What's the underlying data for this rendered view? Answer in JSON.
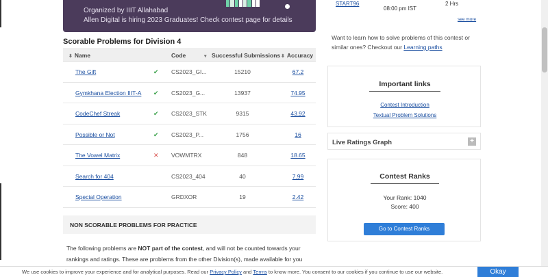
{
  "banner": {
    "line1": "Organized by IIIT Allahabad",
    "line2": "Allen Digital is hiring 2023 Graduates! Check contest page for details",
    "bar_colors": [
      "#6fd3a8",
      "#d8f0e4",
      "#6fd3a8",
      "#ffffff",
      "#d8f0e4",
      "#6fd3a8",
      "#ffffff",
      "#ffffff"
    ]
  },
  "problems": {
    "title": "Scorable Problems for Division 4",
    "headers": {
      "name": "Name",
      "code": "Code",
      "subs": "Successful Submissions",
      "acc": "Accuracy"
    },
    "rows": [
      {
        "name": "The Gift",
        "status": "solved",
        "status_icon": "✔",
        "code": "CS2023_GI...",
        "subs": "15210",
        "acc": "67.2"
      },
      {
        "name": "Gymkhana Election IIIT-A",
        "status": "solved",
        "status_icon": "✔",
        "code": "CS2023_G...",
        "subs": "13937",
        "acc": "74.95"
      },
      {
        "name": "CodeChef Streak",
        "status": "solved",
        "status_icon": "✔",
        "code": "CS2023_STK",
        "subs": "9315",
        "acc": "43.92"
      },
      {
        "name": "Possible or Not",
        "status": "solved",
        "status_icon": "✔",
        "code": "CS2023_P...",
        "subs": "1756",
        "acc": "16"
      },
      {
        "name": "The Vowel Matrix",
        "status": "wrong",
        "status_icon": "✕",
        "code": "VOWMTRX",
        "subs": "848",
        "acc": "18.65"
      },
      {
        "name": "Search for 404",
        "status": "none",
        "status_icon": "",
        "code": "CS2023_404",
        "subs": "40",
        "acc": "7.99"
      },
      {
        "name": "Special Operation",
        "status": "none",
        "status_icon": "",
        "code": "GRDXOR",
        "subs": "19",
        "acc": "2.42"
      }
    ]
  },
  "nonscorable": {
    "label": "NON SCORABLE PROBLEMS FOR PRACTICE",
    "para_pre": "The following problems are ",
    "para_bold": "NOT part of the contest",
    "para_post": ", and will not be counted towards your rankings and ratings. These are problems from the other Division(s), made available for you"
  },
  "sidebar": {
    "calendar": {
      "link": "START96",
      "time": "08:00 pm IST",
      "duration": "2 Hrs",
      "see_more": "see more"
    },
    "learn_text": "Want to learn how to solve problems of this contest or similar ones? Checkout our ",
    "learn_link": "Learning paths",
    "important": {
      "title": "Important links",
      "links": [
        "Contest Introduction",
        "Textual Problem Solutions"
      ]
    },
    "ratings": {
      "label": "Live Ratings Graph",
      "toggle": "+"
    },
    "ranks": {
      "title": "Contest Ranks",
      "your_rank": "Your Rank: 1040",
      "score": "Score: 400",
      "button": "Go to Contest Ranks"
    }
  },
  "cookie": {
    "pre": "We use cookies to improve your experience and for analytical purposes. Read our ",
    "privacy": "Privacy Policy",
    "and": " and ",
    "terms": "Terms",
    "post": " to know more. You consent to our cookies if you continue to use our website.",
    "button": "Okay"
  },
  "colors": {
    "accent": "#2f7ed8",
    "banner": "#4b3b5b",
    "link": "#1a4ea0",
    "ok": "#3aa14a",
    "bad": "#d9534f"
  }
}
